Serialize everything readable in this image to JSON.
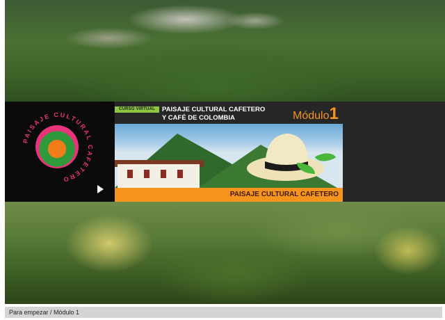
{
  "banner": {
    "logo_text": "PAISAJE CULTURAL CAFETERO",
    "tag": "CURSO VIRTUAL",
    "title_line1": "PAISAJE CULTURAL CAFETERO",
    "title_line2": "Y CAFÉ DE COLOMBIA",
    "modulo_label": "Módulo",
    "modulo_number": "1",
    "orange_label": "PAISAJE CULTURAL CAFETERO"
  },
  "breadcrumb": {
    "text": "Para empezar / Módulo 1"
  },
  "colors": {
    "accent_orange": "#f7941d",
    "tag_green": "#8cc63f",
    "banner_dark": "#262626"
  },
  "icons": [
    "play-icon",
    "coffee-landscape-logo-icon"
  ]
}
